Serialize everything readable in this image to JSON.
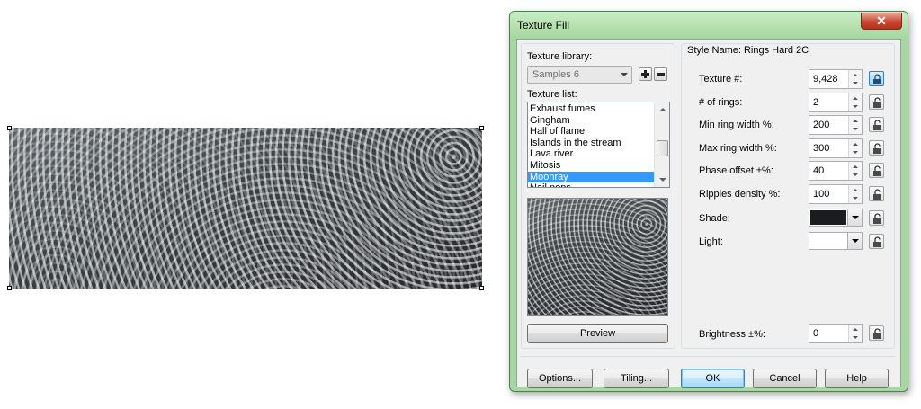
{
  "dialog": {
    "title": "Texture Fill",
    "close_label": "✕",
    "library_label": "Texture library:",
    "library_value": "Samples 6",
    "list_label": "Texture list:",
    "texture_list": [
      "Exhaust fumes",
      "Gingham",
      "Hall of flame",
      "Islands in the stream",
      "Lava river",
      "Mitosis",
      "Moonray",
      "Nail pops"
    ],
    "selected_texture": "Moonray",
    "preview_button": "Preview",
    "style_name": "Style Name: Rings Hard 2C",
    "params": [
      {
        "label": "Texture #:",
        "value": "9,428",
        "locked": true
      },
      {
        "label": "# of rings:",
        "value": "2",
        "locked": false
      },
      {
        "label": "Min ring width %:",
        "value": "200",
        "locked": false
      },
      {
        "label": "Max ring width %:",
        "value": "300",
        "locked": false
      },
      {
        "label": "Phase offset ±%:",
        "value": "40",
        "locked": false
      },
      {
        "label": "Ripples density %:",
        "value": "100",
        "locked": false
      }
    ],
    "shade_label": "Shade:",
    "shade_color": "#1a1c1e",
    "light_label": "Light:",
    "light_color": "#ffffff",
    "brightness_label": "Brightness ±%:",
    "brightness_value": "0",
    "buttons": {
      "options": "Options...",
      "tiling": "Tiling...",
      "ok": "OK",
      "cancel": "Cancel",
      "help": "Help"
    }
  }
}
